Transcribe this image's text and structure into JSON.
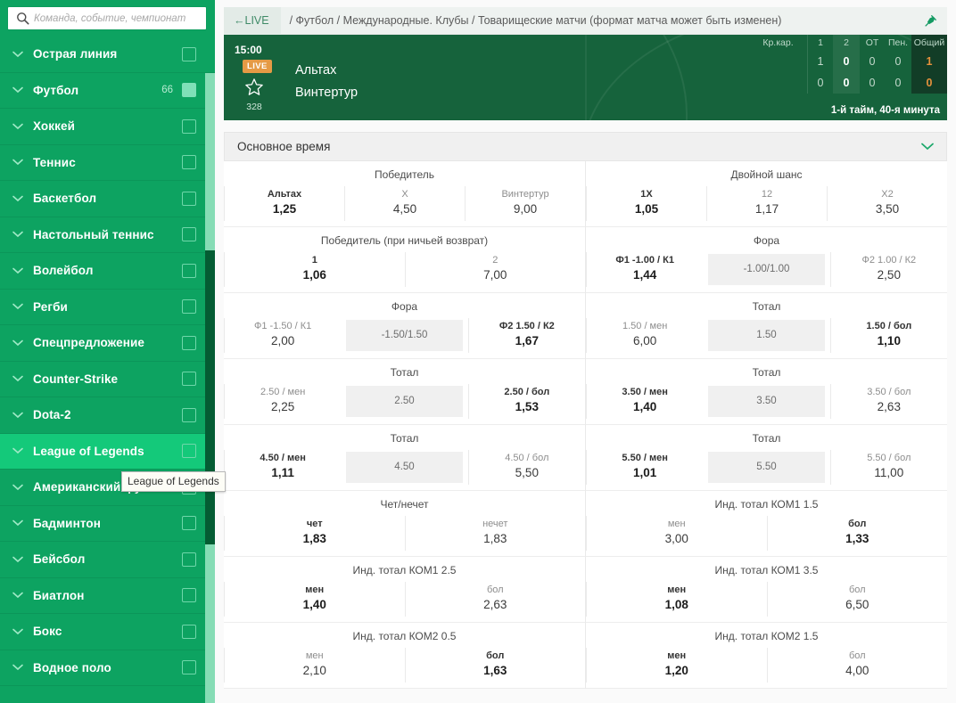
{
  "sidebar": {
    "search": {
      "placeholder": "Команда, событие, чемпионат",
      "value": "",
      "icon": "search-icon"
    },
    "items": [
      {
        "label": "Острая линия",
        "count": "",
        "checked": false,
        "active": false
      },
      {
        "label": "Футбол",
        "count": "66",
        "checked": true,
        "active": false
      },
      {
        "label": "Хоккей",
        "count": "",
        "checked": false,
        "active": false
      },
      {
        "label": "Теннис",
        "count": "",
        "checked": false,
        "active": false
      },
      {
        "label": "Баскетбол",
        "count": "",
        "checked": false,
        "active": false
      },
      {
        "label": "Настольный теннис",
        "count": "",
        "checked": false,
        "active": false
      },
      {
        "label": "Волейбол",
        "count": "",
        "checked": false,
        "active": false
      },
      {
        "label": "Регби",
        "count": "",
        "checked": false,
        "active": false
      },
      {
        "label": "Спецпредложение",
        "count": "",
        "checked": false,
        "active": false
      },
      {
        "label": "Counter-Strike",
        "count": "",
        "checked": false,
        "active": false
      },
      {
        "label": "Dota-2",
        "count": "",
        "checked": false,
        "active": false
      },
      {
        "label": "League of Legends",
        "count": "",
        "checked": false,
        "active": true
      },
      {
        "label": "Американский футбол",
        "count": "",
        "checked": false,
        "active": false
      },
      {
        "label": "Бадминтон",
        "count": "",
        "checked": false,
        "active": false
      },
      {
        "label": "Бейсбол",
        "count": "",
        "checked": false,
        "active": false
      },
      {
        "label": "Биатлон",
        "count": "",
        "checked": false,
        "active": false
      },
      {
        "label": "Бокс",
        "count": "",
        "checked": false,
        "active": false
      },
      {
        "label": "Водное поло",
        "count": "",
        "checked": false,
        "active": false
      }
    ],
    "tooltip": "League of Legends"
  },
  "breadcrumb": {
    "live_label": "←LIVE",
    "path": "/ Футбол / Международные. Клубы / Товарищеские матчи (формат матча может быть изменен)",
    "pin_icon": "pin-icon"
  },
  "match": {
    "time": "15:00",
    "live_badge": "LIVE",
    "favorite_icon": "star-icon",
    "favorite_count": "328",
    "team1": "Альтах",
    "team2": "Винтертур",
    "period": "1-й тайм, 40-я минута",
    "score_headers": [
      "Кр.кар.",
      "1",
      "2",
      "ОТ",
      "Пен.",
      "Общий"
    ],
    "score_row1": [
      "",
      "1",
      "0",
      "0",
      "0",
      "1"
    ],
    "score_row2": [
      "",
      "0",
      "0",
      "0",
      "0",
      "0"
    ]
  },
  "section": {
    "title": "Основное время",
    "collapse_icon": "chevron-down-icon"
  },
  "markets": [
    [
      {
        "title": "Победитель",
        "outcomes": [
          {
            "name": "Альтах",
            "odd": "1,25",
            "bold": true
          },
          {
            "name": "X",
            "odd": "4,50",
            "bold": false
          },
          {
            "name": "Винтертур",
            "odd": "9,00",
            "bold": false
          }
        ]
      },
      {
        "title": "Двойной шанс",
        "outcomes": [
          {
            "name": "1X",
            "odd": "1,05",
            "bold": true
          },
          {
            "name": "12",
            "odd": "1,17",
            "bold": false
          },
          {
            "name": "X2",
            "odd": "3,50",
            "bold": false
          }
        ]
      }
    ],
    [
      {
        "title": "Победитель (при ничьей возврат)",
        "outcomes": [
          {
            "name": "1",
            "odd": "1,06",
            "bold": true
          },
          {
            "name": "2",
            "odd": "7,00",
            "bold": false
          }
        ]
      },
      {
        "title": "Фора",
        "outcomes": [
          {
            "name": "Ф1 -1.00 / К1",
            "odd": "1,44",
            "bold": true
          },
          {
            "line": "-1.00/1.00"
          },
          {
            "name": "Ф2 1.00 / К2",
            "odd": "2,50",
            "bold": false
          }
        ]
      }
    ],
    [
      {
        "title": "Фора",
        "outcomes": [
          {
            "name": "Ф1 -1.50 / К1",
            "odd": "2,00",
            "bold": false
          },
          {
            "line": "-1.50/1.50"
          },
          {
            "name": "Ф2 1.50 / К2",
            "odd": "1,67",
            "bold": true
          }
        ]
      },
      {
        "title": "Тотал",
        "outcomes": [
          {
            "name": "1.50 / мен",
            "odd": "6,00",
            "bold": false
          },
          {
            "line": "1.50"
          },
          {
            "name": "1.50 / бол",
            "odd": "1,10",
            "bold": true
          }
        ]
      }
    ],
    [
      {
        "title": "Тотал",
        "outcomes": [
          {
            "name": "2.50 / мен",
            "odd": "2,25",
            "bold": false
          },
          {
            "line": "2.50"
          },
          {
            "name": "2.50 / бол",
            "odd": "1,53",
            "bold": true
          }
        ]
      },
      {
        "title": "Тотал",
        "outcomes": [
          {
            "name": "3.50 / мен",
            "odd": "1,40",
            "bold": true
          },
          {
            "line": "3.50"
          },
          {
            "name": "3.50 / бол",
            "odd": "2,63",
            "bold": false
          }
        ]
      }
    ],
    [
      {
        "title": "Тотал",
        "outcomes": [
          {
            "name": "4.50 / мен",
            "odd": "1,11",
            "bold": true
          },
          {
            "line": "4.50"
          },
          {
            "name": "4.50 / бол",
            "odd": "5,50",
            "bold": false
          }
        ]
      },
      {
        "title": "Тотал",
        "outcomes": [
          {
            "name": "5.50 / мен",
            "odd": "1,01",
            "bold": true
          },
          {
            "line": "5.50"
          },
          {
            "name": "5.50 / бол",
            "odd": "11,00",
            "bold": false
          }
        ]
      }
    ],
    [
      {
        "title": "Чет/нечет",
        "outcomes": [
          {
            "name": "чет",
            "odd": "1,83",
            "bold": true
          },
          {
            "name": "нечет",
            "odd": "1,83",
            "bold": false
          }
        ]
      },
      {
        "title": "Инд. тотал КОМ1 1.5",
        "outcomes": [
          {
            "name": "мен",
            "odd": "3,00",
            "bold": false
          },
          {
            "name": "бол",
            "odd": "1,33",
            "bold": true
          }
        ]
      }
    ],
    [
      {
        "title": "Инд. тотал КОМ1 2.5",
        "outcomes": [
          {
            "name": "мен",
            "odd": "1,40",
            "bold": true
          },
          {
            "name": "бол",
            "odd": "2,63",
            "bold": false
          }
        ]
      },
      {
        "title": "Инд. тотал КОМ1 3.5",
        "outcomes": [
          {
            "name": "мен",
            "odd": "1,08",
            "bold": true
          },
          {
            "name": "бол",
            "odd": "6,50",
            "bold": false
          }
        ]
      }
    ],
    [
      {
        "title": "Инд. тотал КОМ2 0.5",
        "outcomes": [
          {
            "name": "мен",
            "odd": "2,10",
            "bold": false
          },
          {
            "name": "бол",
            "odd": "1,63",
            "bold": true
          }
        ]
      },
      {
        "title": "Инд. тотал КОМ2 1.5",
        "outcomes": [
          {
            "name": "мен",
            "odd": "1,20",
            "bold": true
          },
          {
            "name": "бол",
            "odd": "4,00",
            "bold": false
          }
        ]
      }
    ]
  ],
  "colors": {
    "brand_green": "#0da361",
    "active_green": "#14c97a",
    "pitch_green": "#16633c",
    "live_orange": "#e59a45",
    "score_orange": "#e5913c"
  }
}
